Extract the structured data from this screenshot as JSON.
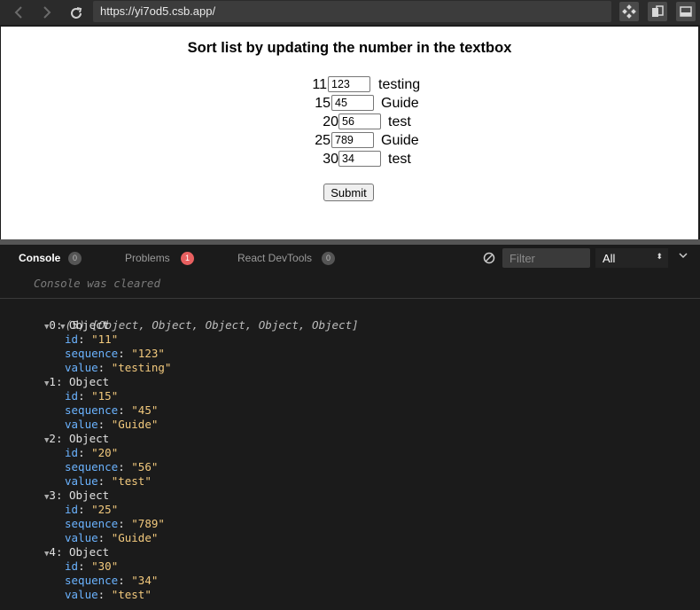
{
  "browser": {
    "url": "https://yi7od5.csb.app/"
  },
  "preview": {
    "title": "Sort list by updating the number in the textbox",
    "items": [
      {
        "id": "11",
        "sequence": "123",
        "value": "testing"
      },
      {
        "id": "15",
        "sequence": "45",
        "value": "Guide"
      },
      {
        "id": "20",
        "sequence": "56",
        "value": "test"
      },
      {
        "id": "25",
        "sequence": "789",
        "value": "Guide"
      },
      {
        "id": "30",
        "sequence": "34",
        "value": "test"
      }
    ],
    "submit_label": "Submit"
  },
  "devtools": {
    "tabs": [
      {
        "label": "Console",
        "count": "0"
      },
      {
        "label": "Problems",
        "count": "1"
      },
      {
        "label": "React DevTools",
        "count": "0"
      }
    ],
    "filter_placeholder": "Filter",
    "level": "All",
    "cleared_message": "Console was cleared",
    "log_summary": "(5) [Object, Object, Object, Object, Object]",
    "objects": [
      {
        "header": "0: Object",
        "id": "\"11\"",
        "sequence": "\"123\"",
        "value": "\"testing\""
      },
      {
        "header": "1: Object",
        "id": "\"15\"",
        "sequence": "\"45\"",
        "value": "\"Guide\""
      },
      {
        "header": "2: Object",
        "id": "\"20\"",
        "sequence": "\"56\"",
        "value": "\"test\""
      },
      {
        "header": "3: Object",
        "id": "\"25\"",
        "sequence": "\"789\"",
        "value": "\"Guide\""
      },
      {
        "header": "4: Object",
        "id": "\"30\"",
        "sequence": "\"34\"",
        "value": "\"test\""
      }
    ],
    "keys": {
      "id": "id",
      "sequence": "sequence",
      "value": "value"
    }
  },
  "colors": {
    "string": "#f2c97d",
    "key": "#6bb3ff",
    "problem_badge": "#e86060"
  }
}
